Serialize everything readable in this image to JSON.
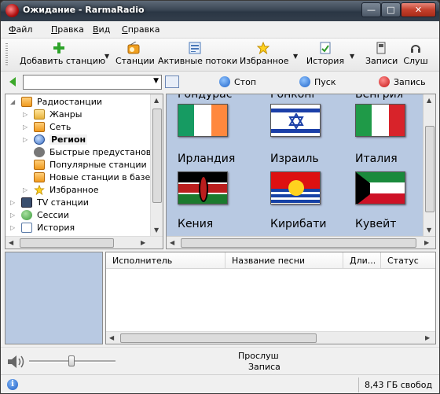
{
  "window": {
    "title": "Ожидание - RarmaRadio"
  },
  "menu": [
    {
      "label": "Файл",
      "key": "Ф",
      "rest": "айл"
    },
    {
      "label": "Правка",
      "key": "П",
      "rest": "равка"
    },
    {
      "label": "Вид",
      "key": "В",
      "rest": "ид"
    },
    {
      "label": "Справка",
      "key": "С",
      "rest": "правка"
    }
  ],
  "toolbar": {
    "add_station": "Добавить станцию",
    "stations": "Станции",
    "active_streams": "Активные потоки",
    "favorites": "Избранное",
    "history": "История",
    "records": "Записи",
    "listen": "Слуш"
  },
  "controls": {
    "stop": "Стоп",
    "play": "Пуск",
    "record": "Запись"
  },
  "tree": {
    "radio_stations": "Радиостанции",
    "genres": "Жанры",
    "network": "Сеть",
    "region": "Регион",
    "quick_presets": "Быстрые предустановки",
    "popular": "Популярные станции в б",
    "new_stations": "Новые станции в базе д",
    "favorites": "Избранное",
    "tv_stations": "TV станции",
    "sessions": "Сессии",
    "history": "История"
  },
  "flags": {
    "row0": [
      "Гондурас",
      "Гонконг",
      "Венгрия"
    ],
    "row1": [
      "Ирландия",
      "Израиль",
      "Италия"
    ],
    "row2": [
      "Кения",
      "Кирибати",
      "Кувейт"
    ]
  },
  "columns": {
    "artist": "Исполнитель",
    "song": "Название песни",
    "length": "Дли...",
    "status": "Статус"
  },
  "player": {
    "listened": "Прослуш",
    "recorded": "Записа"
  },
  "status": {
    "free_space": "8,43 ГБ свобод"
  }
}
